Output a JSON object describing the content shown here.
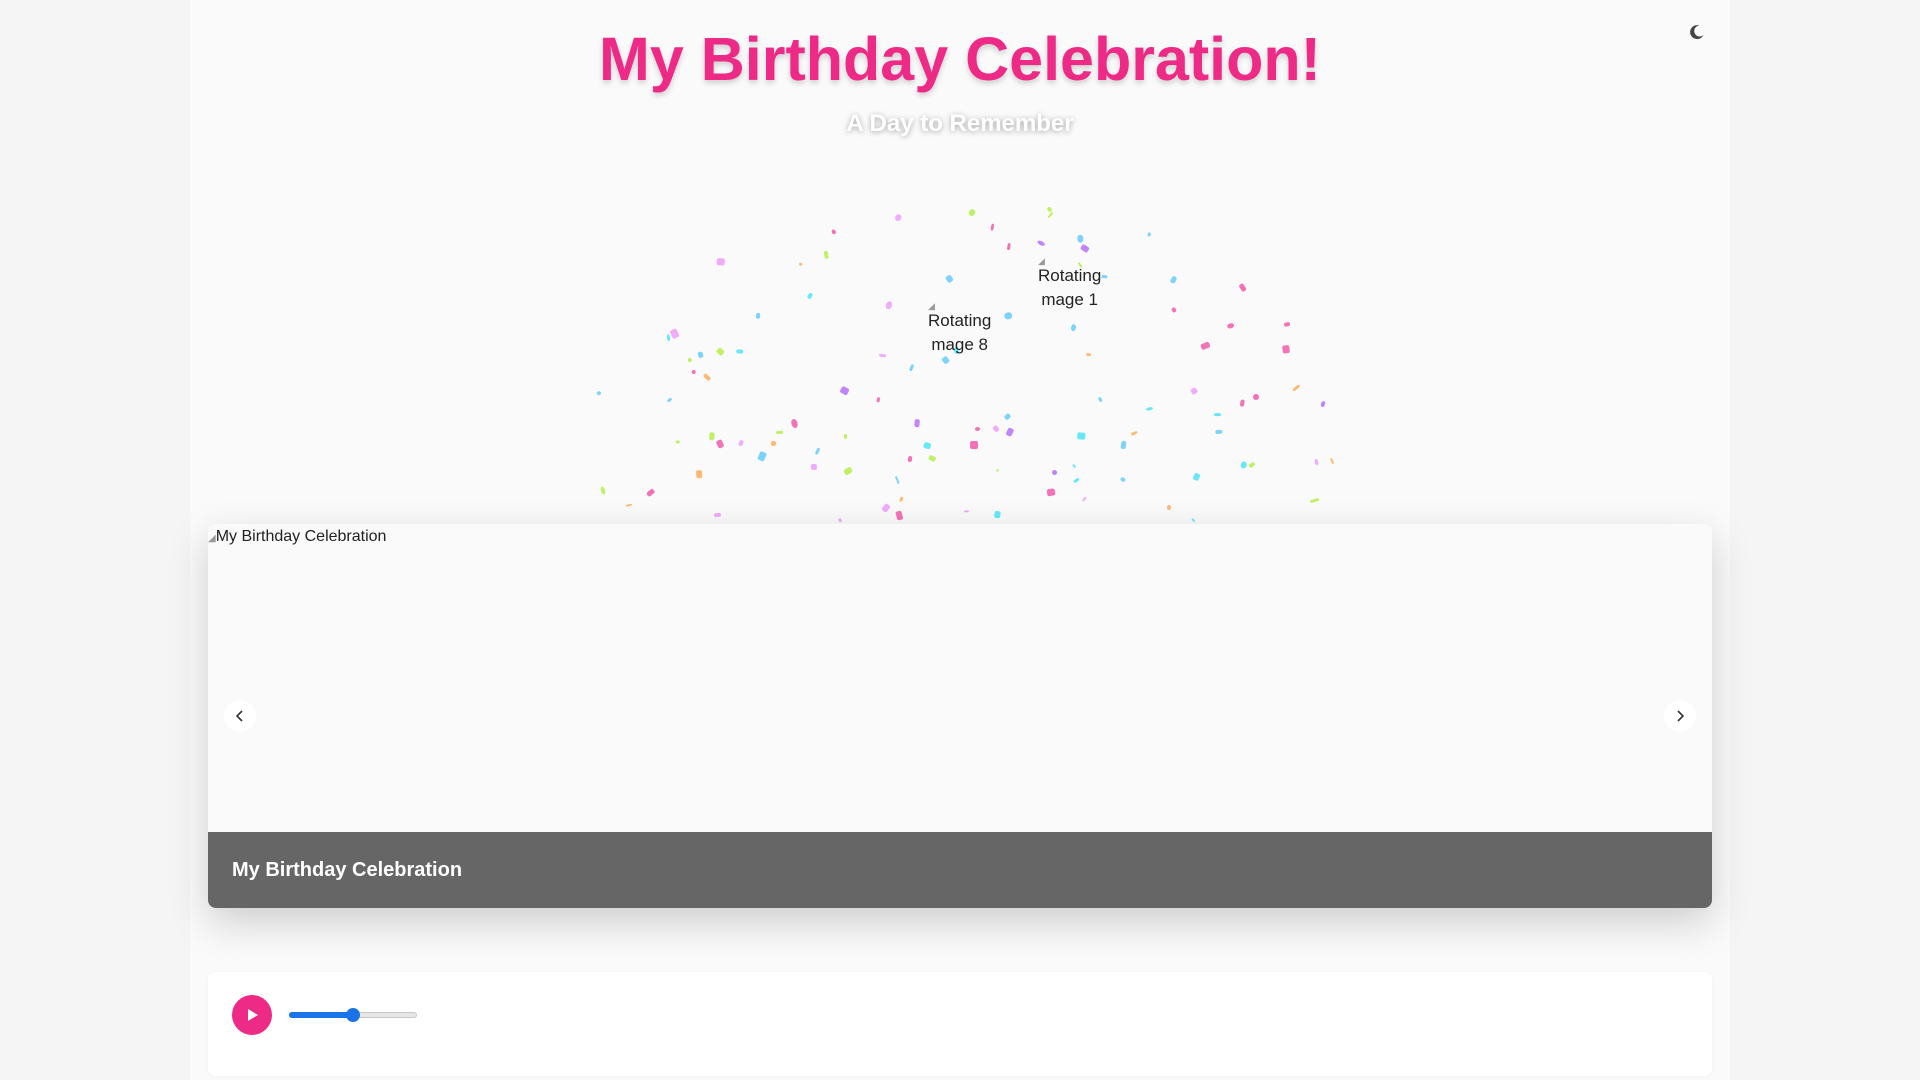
{
  "header": {
    "title": "My Birthday Celebration!",
    "subtitle": "A Day to Remember",
    "theme_toggle_icon": "moon-icon"
  },
  "rotating_images": [
    {
      "alt_line1": "Rotating",
      "alt_line2": "mage 1"
    },
    {
      "alt_line1": "Rotating",
      "alt_line2": "mage 8"
    }
  ],
  "carousel": {
    "image_alt": "My Birthday Celebration",
    "caption": "My Birthday Celebration",
    "prev_icon": "chevron-left-icon",
    "next_icon": "chevron-right-icon"
  },
  "player": {
    "play_icon": "play-icon",
    "volume_level": 0.5
  },
  "colors": {
    "accent": "#ee2a87",
    "caption_bg": "#666666",
    "slider": "#1a73e8",
    "confetti": [
      "#7dd3fc",
      "#f0abfc",
      "#fdba74",
      "#bef264",
      "#c084fc",
      "#f472b6",
      "#67e8f9"
    ]
  }
}
